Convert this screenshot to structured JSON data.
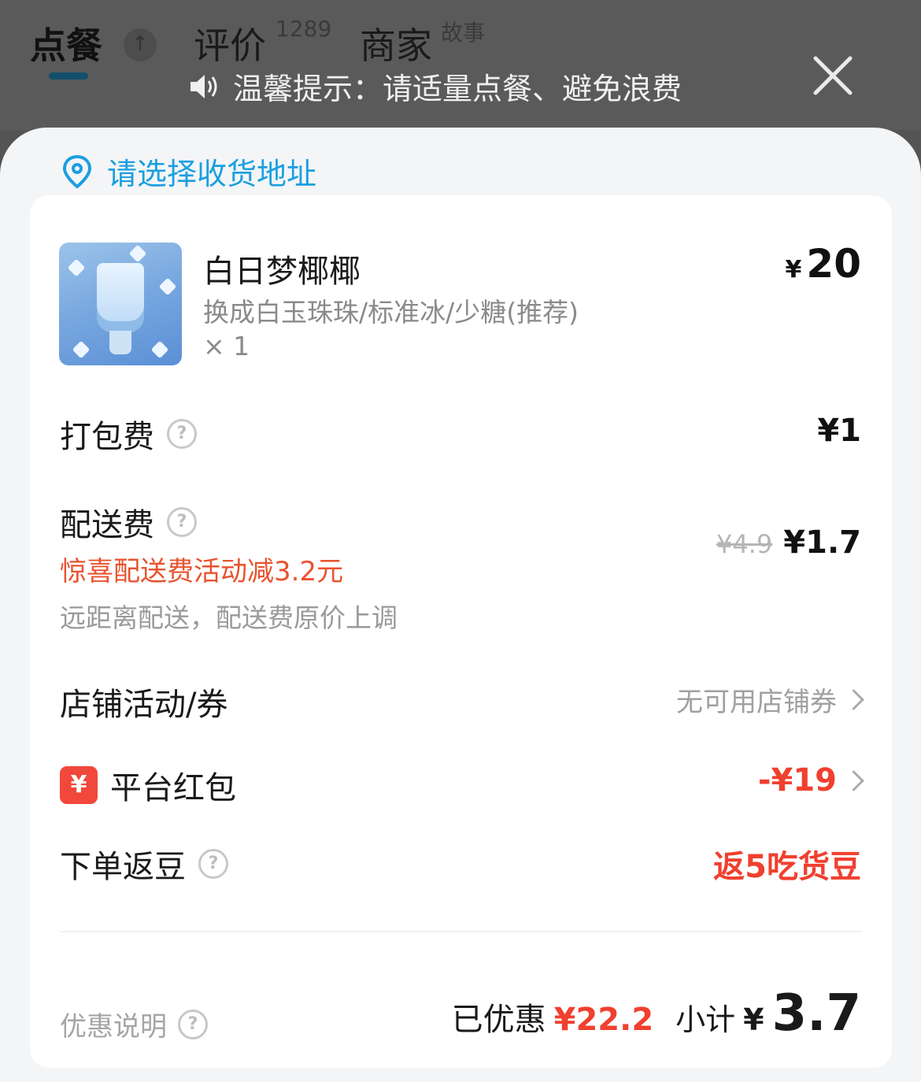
{
  "tabs": {
    "order": "点餐",
    "reviews": "评价",
    "reviews_count": "1289",
    "merchant": "商家",
    "merchant_sup": "故事"
  },
  "tip": {
    "text": "温馨提示：请适量点餐、避免浪费"
  },
  "address": {
    "prompt": "请选择收货地址"
  },
  "item": {
    "name": "白日梦椰椰",
    "spec": "换成白玉珠珠/标准冰/少糖(推荐)",
    "qty": "× 1",
    "currency": "¥",
    "price": "20"
  },
  "packing": {
    "label": "打包费",
    "value": "¥1"
  },
  "delivery": {
    "label": "配送费",
    "promo": "惊喜配送费活动减3.2元",
    "note": "远距离配送，配送费原价上调",
    "original": "¥4.9",
    "value": "¥1.7"
  },
  "store_coupon": {
    "label": "店铺活动/券",
    "value": "无可用店铺券"
  },
  "platform_redpack": {
    "icon_text": "¥",
    "label": "平台红包",
    "value": "-¥19"
  },
  "beans": {
    "label": "下单返豆",
    "value": "返5吃货豆"
  },
  "footer": {
    "discount_note": "优惠说明",
    "saved_label": "已优惠",
    "saved_value": "¥22.2",
    "subtotal_label": "小计",
    "subtotal_currency": "¥",
    "subtotal_value": "3.7"
  },
  "colors": {
    "accent_blue": "#1b9fe0",
    "accent_red": "#f0402f",
    "promo_orange": "#e8532f"
  }
}
